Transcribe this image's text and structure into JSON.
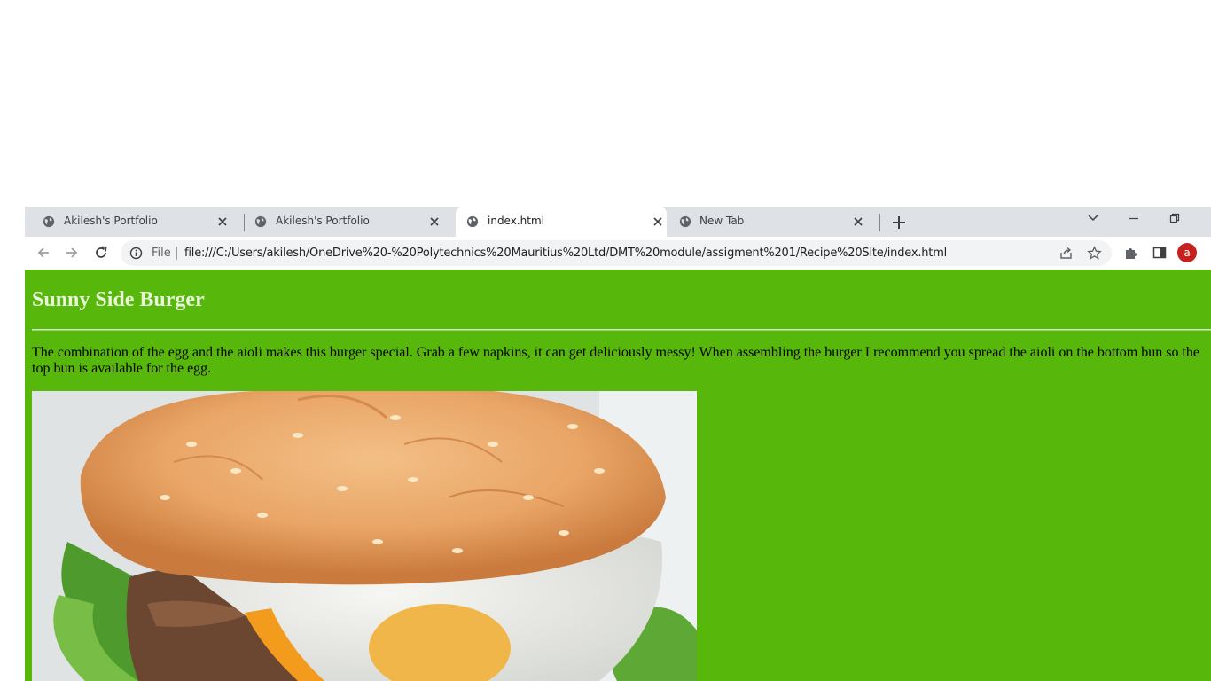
{
  "tabs": [
    {
      "title": "Akilesh's Portfolio",
      "active": false
    },
    {
      "title": "Akilesh's Portfolio",
      "active": false
    },
    {
      "title": "index.html",
      "active": true
    },
    {
      "title": "New Tab",
      "active": false
    }
  ],
  "toolbar": {
    "scheme_label": "File",
    "url": "file:///C:/Users/akilesh/OneDrive%20-%20Polytechnics%20Mauritius%20Ltd/DMT%20module/assigment%201/Recipe%20Site/index.html",
    "avatar_letter": "a"
  },
  "page": {
    "heading": "Sunny Side Burger",
    "description": "The combination of the egg and the aioli makes this burger special. Grab a few napkins, it can get deliciously messy! When assembling the burger I recommend you spread the aioli on the bottom bun so the top bun is available for the egg.",
    "background_color": "#57b70a"
  },
  "icons": {
    "back": "arrow-left-icon",
    "forward": "arrow-right-icon",
    "reload": "reload-icon",
    "info": "info-icon",
    "share": "share-icon",
    "bookmark": "star-icon",
    "extensions": "puzzle-icon",
    "side_panel": "side-panel-icon",
    "new_tab": "plus-icon",
    "tab_search": "chevron-down-icon",
    "minimize": "minimize-icon",
    "restore": "restore-icon",
    "close_tab": "close-icon",
    "favicon": "globe-icon"
  }
}
